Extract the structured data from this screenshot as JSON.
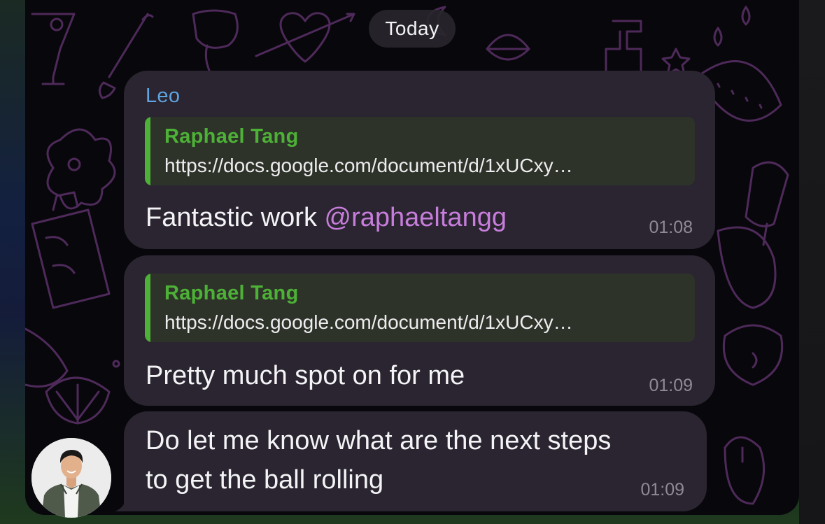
{
  "date_separator": "Today",
  "messages": [
    {
      "sender": "Leo",
      "quote": {
        "author": "Raphael Tang",
        "text": "https://docs.google.com/document/d/1xUCxy…"
      },
      "text": "Fantastic work ",
      "mention": "@raphaeltangg",
      "time": "01:08"
    },
    {
      "quote": {
        "author": "Raphael Tang",
        "text": "https://docs.google.com/document/d/1xUCxy…"
      },
      "text": "Pretty much spot on for me",
      "time": "01:09"
    },
    {
      "text_line1": "Do let me know what are the next steps",
      "text_line2": "to get the ball rolling",
      "time": "01:09"
    }
  ],
  "colors": {
    "bubble": "#2a2530",
    "sender_name": "#5fa3e0",
    "quote_accent": "#4db137",
    "mention": "#c77ddb",
    "timestamp": "#8f8a96",
    "doodle": "#5a2f66"
  },
  "icons": [
    "doodle-pattern-background",
    "user-avatar"
  ]
}
